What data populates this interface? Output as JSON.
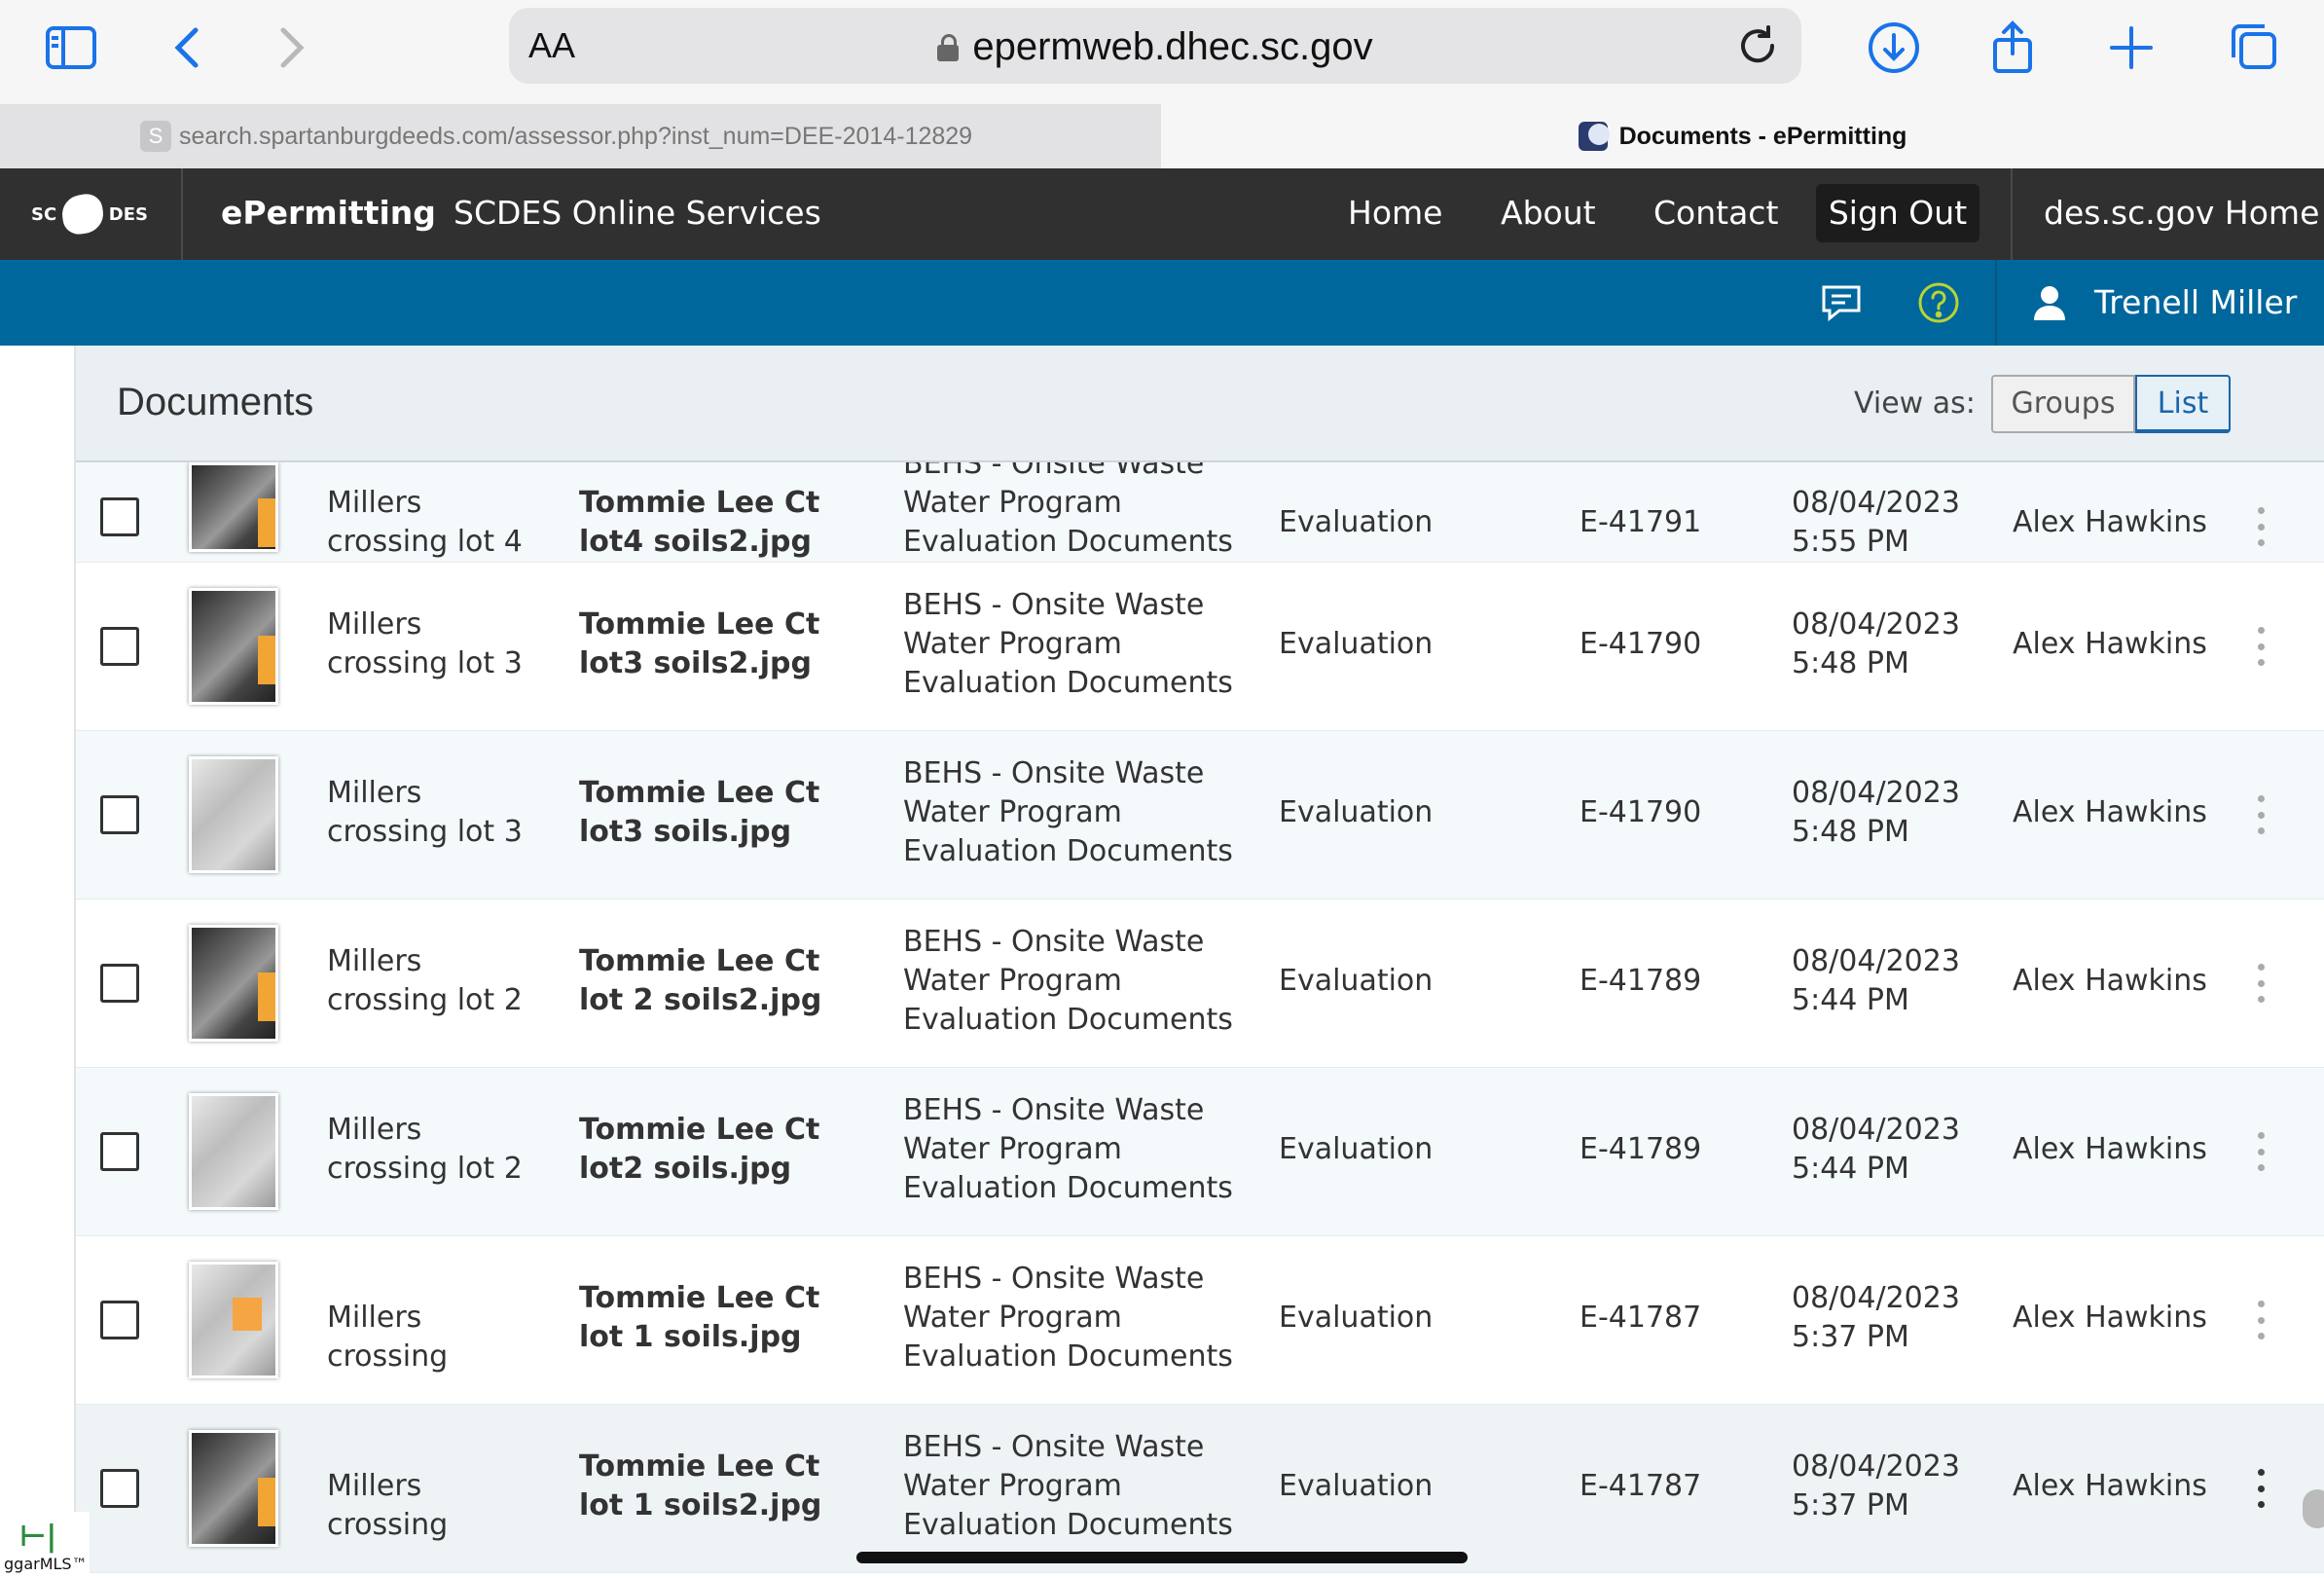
{
  "browser": {
    "aa_label": "AA",
    "url": "epermweb.dhec.sc.gov",
    "tabs": [
      {
        "favicon_letter": "S",
        "title": "search.spartanburgdeeds.com/assessor.php?inst_num=DEE-2014-12829"
      },
      {
        "title": "Documents - ePermitting"
      }
    ],
    "tab_close_glyph": "×"
  },
  "header": {
    "logo_left": "SC",
    "logo_right": "DES",
    "title": "ePermitting",
    "subtitle": "SCDES Online Services",
    "nav": {
      "home": "Home",
      "about": "About",
      "contact": "Contact",
      "sign_out": "Sign Out",
      "des_home": "des.sc.gov Home"
    }
  },
  "user_bar": {
    "user_name": "Trenell Miller"
  },
  "documents": {
    "title": "Documents",
    "view_as_label": "View as:",
    "view_options": [
      "Groups",
      "List"
    ],
    "selected_view": "List",
    "rows": [
      {
        "name": "Millers crossing lot 4",
        "file": "Tommie Lee Ct lot4 soils2.jpg",
        "type": "BEHS - Onsite Waste Water Program Evaluation Documents",
        "category": "Evaluation",
        "number": "E-41791",
        "date": "08/04/2023",
        "time": "5:55 PM",
        "user": "Alex Hawkins",
        "thumb": "dark"
      },
      {
        "name": "Millers crossing lot 3",
        "file": "Tommie Lee Ct lot3 soils2.jpg",
        "type": "BEHS - Onsite Waste Water Program Evaluation Documents",
        "category": "Evaluation",
        "number": "E-41790",
        "date": "08/04/2023",
        "time": "5:48 PM",
        "user": "Alex Hawkins",
        "thumb": "dark"
      },
      {
        "name": "Millers crossing lot 3",
        "file": "Tommie Lee Ct lot3 soils.jpg",
        "type": "BEHS - Onsite Waste Water Program Evaluation Documents",
        "category": "Evaluation",
        "number": "E-41790",
        "date": "08/04/2023",
        "time": "5:48 PM",
        "user": "Alex Hawkins",
        "thumb": "light"
      },
      {
        "name": "Millers crossing lot 2",
        "file": "Tommie Lee Ct lot 2 soils2.jpg",
        "type": "BEHS - Onsite Waste Water Program Evaluation Documents",
        "category": "Evaluation",
        "number": "E-41789",
        "date": "08/04/2023",
        "time": "5:44 PM",
        "user": "Alex Hawkins",
        "thumb": "dark"
      },
      {
        "name": "Millers crossing lot 2",
        "file": "Tommie Lee Ct lot2 soils.jpg",
        "type": "BEHS - Onsite Waste Water Program Evaluation Documents",
        "category": "Evaluation",
        "number": "E-41789",
        "date": "08/04/2023",
        "time": "5:44 PM",
        "user": "Alex Hawkins",
        "thumb": "light"
      },
      {
        "name": "Millers crossing",
        "file": "Tommie Lee Ct lot 1 soils.jpg",
        "type": "BEHS - Onsite Waste Water Program Evaluation Documents",
        "category": "Evaluation",
        "number": "E-41787",
        "date": "08/04/2023",
        "time": "5:37 PM",
        "user": "Alex Hawkins",
        "thumb": "light orange"
      },
      {
        "name": "Millers crossing",
        "file": "Tommie Lee Ct lot 1 soils2.jpg",
        "type": "BEHS - Onsite Waste Water Program Evaluation Documents",
        "category": "Evaluation",
        "number": "E-41787",
        "date": "08/04/2023",
        "time": "5:37 PM",
        "user": "Alex Hawkins",
        "thumb": "dark"
      }
    ]
  },
  "overlay_badge": {
    "text": "ggarMLS™"
  },
  "colors": {
    "header_bg": "#303030",
    "blue_bar": "#00679c",
    "accent": "#1b65a8",
    "row_alt": "#f4f9fc"
  }
}
